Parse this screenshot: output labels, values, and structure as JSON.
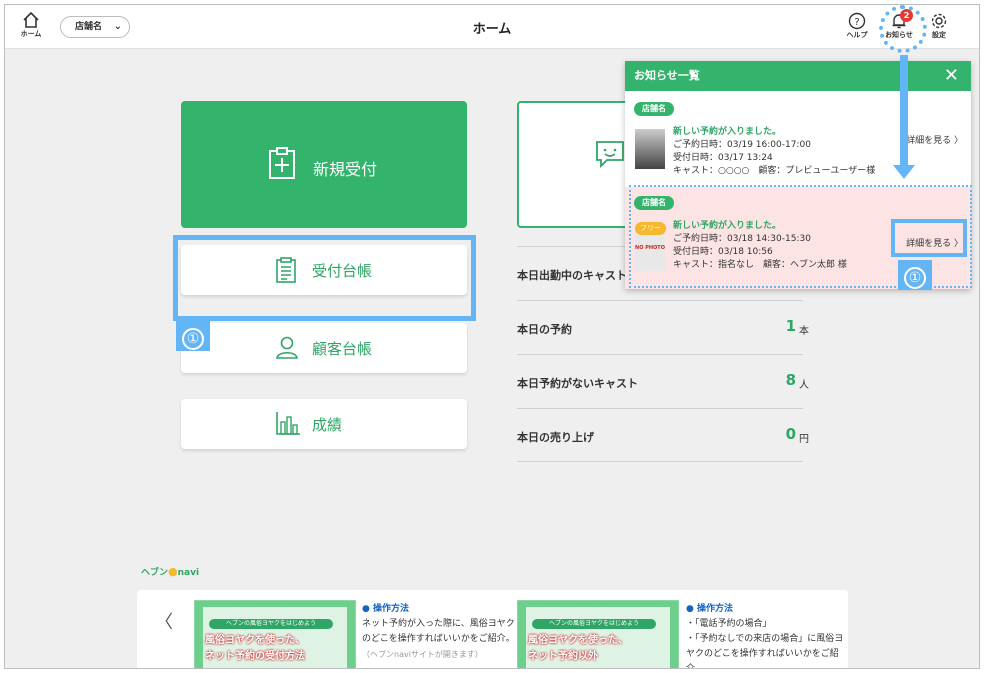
{
  "header": {
    "home_label": "ホーム",
    "store_select": "店舗名",
    "title": "ホーム",
    "help_label": "ヘルプ",
    "notice_label": "お知らせ",
    "notice_count": "2",
    "settings_label": "設定"
  },
  "menu": {
    "new_reception": "新規受付",
    "reception_ledger": "受付台帳",
    "customer_ledger": "顧客台帳",
    "results": "成績"
  },
  "stats": [
    {
      "label": "本日出勤中のキャスト",
      "value": "",
      "unit": ""
    },
    {
      "label": "本日の予約",
      "value": "1",
      "unit": "本"
    },
    {
      "label": "本日予約がないキャスト",
      "value": "8",
      "unit": "人"
    },
    {
      "label": "本日の売り上げ",
      "value": "0",
      "unit": "円"
    }
  ],
  "callouts": {
    "num": "①"
  },
  "notifications": {
    "title": "お知らせ一覧",
    "close": "✕",
    "items": [
      {
        "store": "店舗名",
        "headline": "新しい予約が入りました。",
        "line1": "ご予約日時：03/19 16:00-17:00",
        "line2": "受付日時：03/17 13:24",
        "line3": "キャスト：○○○○　顧客：プレビューユーザー様",
        "detail": "詳細を見る"
      },
      {
        "store": "店舗名",
        "tag": "フリー",
        "thumb_text": "NO PHOTO",
        "headline": "新しい予約が入りました。",
        "line1": "ご予約日時：03/18 14:30-15:30",
        "line2": "受付日時：03/18 10:56",
        "line3": "キャスト：指名なし　顧客：ヘブン太郎 様",
        "detail": "詳細を見る"
      }
    ]
  },
  "navi": {
    "logo_left": "ヘブン",
    "logo_right": "navi",
    "prev": "〈",
    "cards": [
      {
        "sub": "ヘブンの風俗ヨヤクをはじめよう",
        "title1": "風俗ヨヤクを使った、",
        "title2": "ネット予約の受付方法",
        "heading": "● 操作方法",
        "text": "ネット予約が入った際に、風俗ヨヤクのどこを操作すればいいかをご紹介。",
        "text2": "（ヘブンnaviサイトが開きます）"
      },
      {
        "sub": "ヘブンの風俗ヨヤクをはじめよう",
        "title1": "風俗ヨヤクを使った、",
        "title2": "ネット予約以外",
        "heading": "● 操作方法",
        "text": "・「電話予約の場合」",
        "text2": "・「予約なしでの来店の場合」に風俗ヨヤクのどこを操作すればいいかをご紹介。"
      }
    ]
  }
}
